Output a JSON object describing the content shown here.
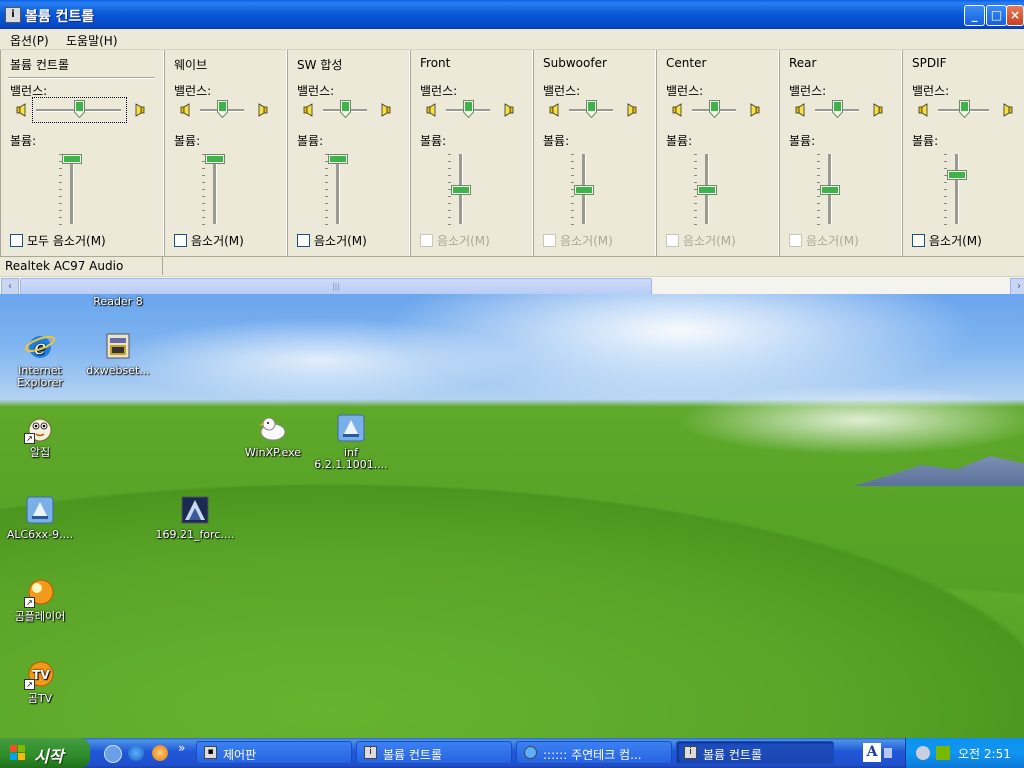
{
  "window": {
    "title": "볼륨 컨트롤",
    "menu": [
      "옵션(P)",
      "도움말(H)"
    ],
    "status": "Realtek AC97 Audio",
    "minimize_glyph": "_",
    "maximize_glyph": "□",
    "close_glyph": "×",
    "scroll_left_glyph": "‹",
    "scroll_right_glyph": "›",
    "scroll_thumb_glyph": "|||"
  },
  "labels": {
    "balance": "밸런스:",
    "volume": "볼륨:",
    "mute": "음소거(M)",
    "mute_all": "모두 음소거(M)"
  },
  "channels": [
    {
      "name": "볼륨 컨트롤",
      "balance": 0.5,
      "volume": 0.95,
      "mute_label": "모두 음소거(M)",
      "mute_enabled": true,
      "muted": false
    },
    {
      "name": "웨이브",
      "balance": 0.5,
      "volume": 0.95,
      "mute_label": "음소거(M)",
      "mute_enabled": true,
      "muted": false
    },
    {
      "name": "SW 합성",
      "balance": 0.5,
      "volume": 0.95,
      "mute_label": "음소거(M)",
      "mute_enabled": true,
      "muted": false
    },
    {
      "name": "Front",
      "balance": 0.5,
      "volume": 0.5,
      "mute_label": "음소거(M)",
      "mute_enabled": false,
      "muted": false
    },
    {
      "name": "Subwoofer",
      "balance": 0.5,
      "volume": 0.5,
      "mute_label": "음소거(M)",
      "mute_enabled": false,
      "muted": false
    },
    {
      "name": "Center",
      "balance": 0.5,
      "volume": 0.5,
      "mute_label": "음소거(M)",
      "mute_enabled": false,
      "muted": false
    },
    {
      "name": "Rear",
      "balance": 0.5,
      "volume": 0.5,
      "mute_label": "음소거(M)",
      "mute_enabled": false,
      "muted": false
    },
    {
      "name": "SPDIF",
      "balance": 0.5,
      "volume": 0.72,
      "mute_label": "음소거(M)",
      "mute_enabled": true,
      "muted": false
    }
  ],
  "desktop_icons": [
    {
      "label": "Reader 8",
      "icon": "adobe-reader-icon"
    },
    {
      "label": "Internet Explorer",
      "icon": "internet-explorer-icon"
    },
    {
      "label": "dxwebset...",
      "icon": "installer-icon"
    },
    {
      "label": "알집",
      "icon": "alzip-icon"
    },
    {
      "label": "WinXP.exe",
      "icon": "winxp-exe-icon"
    },
    {
      "label": "inf 6.2.1.1001....",
      "icon": "setup-icon"
    },
    {
      "label": "ALC6xx-9....",
      "icon": "setup-icon"
    },
    {
      "label": "169.21_forc....",
      "icon": "nvidia-driver-icon"
    },
    {
      "label": "곰플레이어",
      "icon": "gom-player-icon"
    },
    {
      "label": "곰TV",
      "icon": "gom-tv-icon"
    }
  ],
  "taskbar": {
    "start_label": "시작",
    "quick_launch_more": "»",
    "tasks": [
      {
        "label": "제어판",
        "active": false
      },
      {
        "label": "볼륨 컨트롤",
        "active": false
      },
      {
        "label": ":::::: 주연테크 컴...",
        "active": false
      },
      {
        "label": "볼륨 컨트롤",
        "active": true
      }
    ],
    "lang_label": "A",
    "clock": "오전 2:51"
  },
  "colors": {
    "titlebar": "#0a5ad8",
    "taskbar": "#2157d7",
    "start": "#2f8c2a",
    "tray": "#1096ef",
    "face": "#ece9d8"
  }
}
